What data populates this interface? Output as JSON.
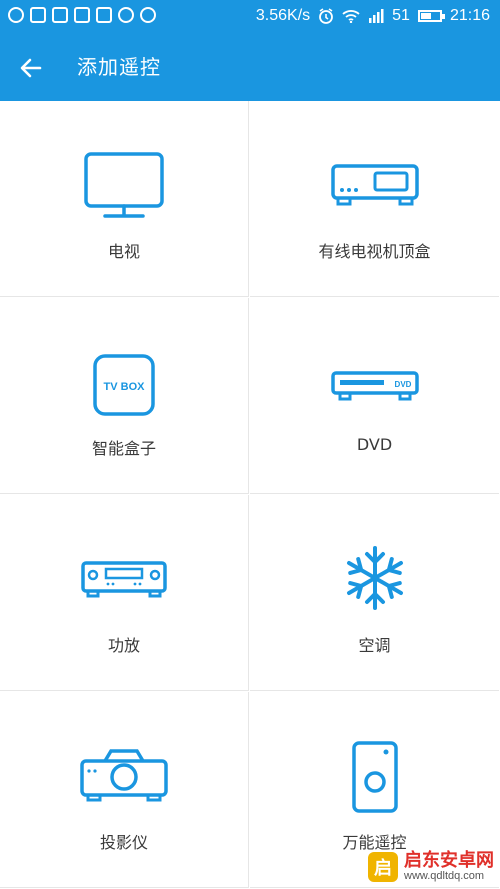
{
  "status_bar": {
    "speed": "3.56K/s",
    "signal": "51",
    "time": "21:16",
    "battery_level": 0.55,
    "left_icons": [
      "qq-icon",
      "gallery-icon",
      "apps-icon",
      "weibo-icon",
      "lofter-icon",
      "messenger-icon",
      "more-icon"
    ]
  },
  "app_bar": {
    "title": "添加遥控",
    "back_icon": "arrow-left-icon"
  },
  "devices": [
    {
      "label": "电视",
      "icon": "tv-icon"
    },
    {
      "label": "有线电视机顶盒",
      "icon": "set-top-box-icon"
    },
    {
      "label": "智能盒子",
      "icon": "tv-box-icon",
      "icon_text": "TV BOX"
    },
    {
      "label": "DVD",
      "icon": "dvd-player-icon",
      "icon_text": "DVD"
    },
    {
      "label": "功放",
      "icon": "amplifier-icon"
    },
    {
      "label": "空调",
      "icon": "snowflake-icon"
    },
    {
      "label": "投影仪",
      "icon": "projector-icon"
    },
    {
      "label": "万能遥控",
      "icon": "universal-remote-icon"
    }
  ],
  "watermark": {
    "title": "启东安卓网",
    "url": "www.qdltdq.com",
    "logo_char": "启"
  },
  "colors": {
    "primary": "#1a96e0",
    "icon": "#1a96e0",
    "label": "#3a3a3a",
    "divider": "#e6e6e6"
  }
}
